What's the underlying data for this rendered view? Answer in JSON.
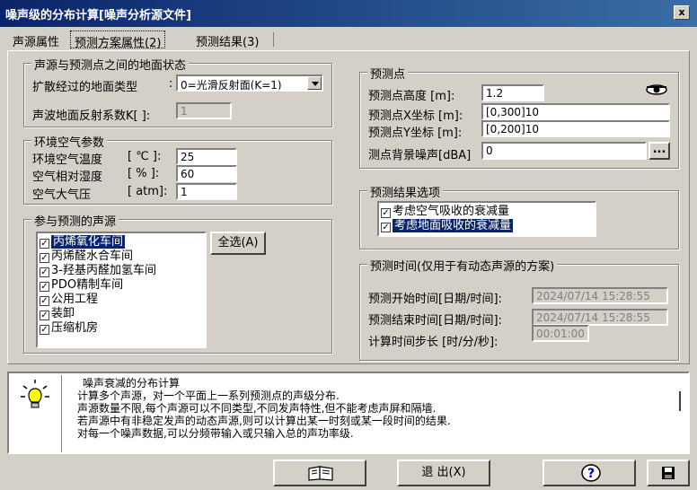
{
  "window": {
    "title": "噪声级的分布计算[噪声分析源文件]",
    "close_label": "x"
  },
  "tabs": [
    {
      "label": "声源属性"
    },
    {
      "label": "预测方案属性(2)"
    },
    {
      "label": "预测结果(3)"
    }
  ],
  "ground": {
    "title": "声源与预测点之间的地面状态",
    "type_label": "扩散经过的地面类型",
    "type_colon": ":",
    "type_value": "0=光滑反射面(K=1)",
    "k_label": "声波地面反射系数K[ ]:",
    "k_value": "1"
  },
  "air": {
    "title": "环境空气参数",
    "temp_label": "环境空气温度",
    "temp_unit": "[ ℃ ]:",
    "temp_value": "25",
    "humidity_label": "空气相对湿度",
    "humidity_unit": "[  % ]:",
    "humidity_value": "60",
    "pressure_label": "空气大气压",
    "pressure_unit": "[ atm]:",
    "pressure_value": "1"
  },
  "sources": {
    "title": "参与预测的声源",
    "select_all_label": "全选(A)",
    "items": [
      {
        "label": "丙烯氧化车间",
        "checked": true,
        "selected": true
      },
      {
        "label": "丙烯醛水合车间",
        "checked": true,
        "selected": false
      },
      {
        "label": "3-羟基丙醛加氢车间",
        "checked": true,
        "selected": false
      },
      {
        "label": "PDO精制车间",
        "checked": true,
        "selected": false
      },
      {
        "label": "公用工程",
        "checked": true,
        "selected": false
      },
      {
        "label": "装卸",
        "checked": true,
        "selected": false
      },
      {
        "label": "压缩机房",
        "checked": true,
        "selected": false
      }
    ]
  },
  "points": {
    "title": "预测点",
    "height_label": "预测点高度  [m]:",
    "height_value": "1.2",
    "x_label": "预测点X坐标 [m]:",
    "x_value": "[0,300]10",
    "y_label": "预测点Y坐标 [m]:",
    "y_value": "[0,200]10",
    "bg_label": "测点背景噪声[dBA]",
    "bg_value": "0",
    "more_label": "...",
    "eye_icon": "eye-icon"
  },
  "options": {
    "title": "预测结果选项",
    "items": [
      {
        "label": "考虑空气吸收的衰减量",
        "checked": true,
        "selected": false
      },
      {
        "label": "考虑地面吸收的衰减量",
        "checked": true,
        "selected": true
      }
    ]
  },
  "time": {
    "title": "预测时间(仅用于有动态声源的方案)",
    "start_label": "预测开始时间[日期/时间]:",
    "start_value": "2024/07/14 15:28:55",
    "end_label": "预测结束时间[日期/时间]:",
    "end_value": "2024/07/14 15:28:55",
    "step_label": "计算时间步长 [时/分/秒]:",
    "step_value": "00:01:00"
  },
  "info": {
    "icon": "lightbulb-icon",
    "lines": [
      "噪声衰减的分布计算",
      "计算多个声源，对一个平面上一系列预测点的声级分布.",
      "声源数量不限,每个声源可以不同类型,不同发声特性,但不能考虑声屏和隔墙.",
      "若声源中有非稳定发声的动态声源,则可以计算出某一时刻或某一段时间的结果.",
      "对每一个噪声数据,可以分频带输入或只输入总的声功率级."
    ]
  },
  "footer": {
    "book_icon": "book-icon",
    "exit_label": "退 出(X)",
    "help_icon": "help-icon",
    "save_icon": "save-icon"
  },
  "colors": {
    "titlebar": "#0a246a",
    "selection": "#0a246a",
    "face": "#d4d0c8"
  }
}
